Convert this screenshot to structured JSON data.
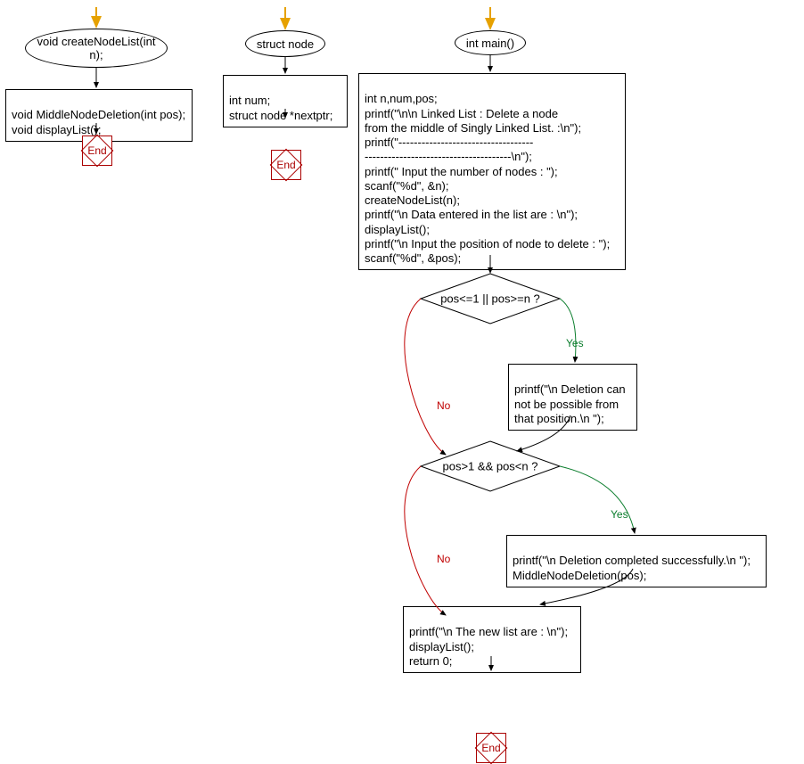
{
  "chart_data": {
    "type": "flowchart",
    "subgraphs": [
      {
        "entry": "void createNodeList(int n);",
        "body": "void MiddleNodeDeletion(int pos);\nvoid displayList();",
        "terminator": "End"
      },
      {
        "entry": "struct node",
        "body": "int num;\nstruct node *nextptr;",
        "terminator": "End"
      },
      {
        "entry": "int main()",
        "body": "int n,num,pos;\nprintf(\"\\n\\n Linked List : Delete a node from the middle of Singly Linked List. :\\n\");\nprintf(\"-------------------------------------------------------------------------\\n\");\nprintf(\" Input the number of nodes : \");\nscanf(\"%d\", &n);\ncreateNodeList(n);\nprintf(\"\\n Data entered in the list are : \\n\");\ndisplayList();\nprintf(\"\\n Input the position of node to delete : \");\nscanf(\"%d\", &pos);",
        "decisions": [
          {
            "condition": "pos<=1 || pos>=n ?",
            "yes": "printf(\"\\n Deletion can not be possible from that position.\\n \");",
            "no": "→ next decision"
          },
          {
            "condition": "pos>1 && pos<n ?",
            "yes": "printf(\"\\n Deletion completed successfully.\\n \");\nMiddleNodeDeletion(pos);",
            "no": "→ merge"
          }
        ],
        "merge": "printf(\"\\n The new list are  : \\n\");\ndisplayList();\nreturn 0;",
        "terminator": "End"
      }
    ],
    "edge_labels": {
      "yes": "Yes",
      "no": "No"
    }
  },
  "flow1": {
    "entry": "void createNodeList(int\nn);",
    "body": "void MiddleNodeDeletion(int pos);\nvoid displayList();",
    "end": "End"
  },
  "flow2": {
    "entry": "struct node",
    "body": "int num;\nstruct node *nextptr;",
    "end": "End"
  },
  "flow3": {
    "entry": "int main()",
    "body": "int n,num,pos;\nprintf(\"\\n\\n Linked List : Delete a node\nfrom the middle of Singly Linked List. :\\n\");\nprintf(\"-----------------------------------\n--------------------------------------\\n\");\nprintf(\" Input the number of nodes : \");\nscanf(\"%d\", &n);\ncreateNodeList(n);\nprintf(\"\\n Data entered in the list are : \\n\");\ndisplayList();\nprintf(\"\\n Input the position of node to delete : \");\nscanf(\"%d\", &pos);",
    "cond1": "pos<=1 || pos>=n ?",
    "yes1": "printf(\"\\n Deletion can\nnot be possible from\nthat position.\\n \");",
    "cond2": "pos>1 && pos<n ?",
    "yes2": "printf(\"\\n Deletion completed successfully.\\n \");\nMiddleNodeDeletion(pos);",
    "merge": "printf(\"\\n The new list are  : \\n\");\ndisplayList();\nreturn 0;",
    "end": "End"
  },
  "labels": {
    "yes": "Yes",
    "no": "No"
  }
}
